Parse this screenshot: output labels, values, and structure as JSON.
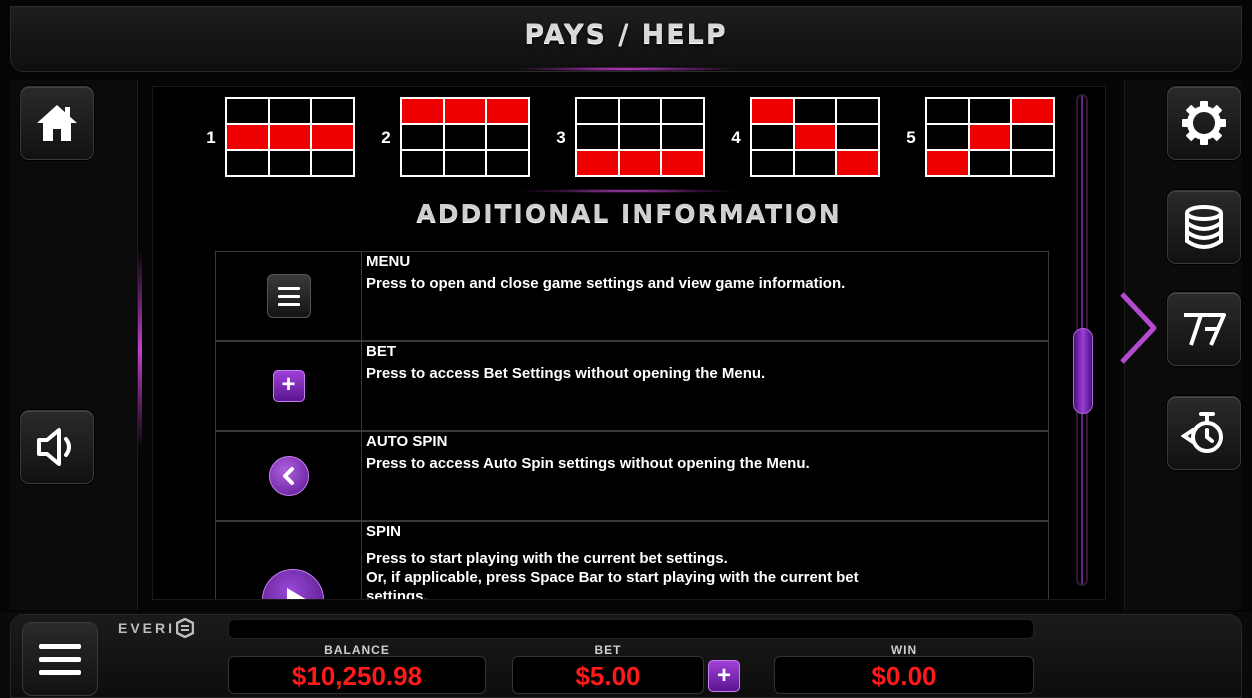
{
  "header": {
    "title": "PAYS / HELP"
  },
  "left_buttons": [
    {
      "name": "home",
      "icon": "home-icon"
    },
    {
      "name": "sound",
      "icon": "speaker-icon"
    }
  ],
  "right_buttons": [
    {
      "name": "settings",
      "icon": "gear-icon"
    },
    {
      "name": "bet-settings",
      "icon": "coin-stack-icon"
    },
    {
      "name": "paytable",
      "icon": "sevens-icon"
    },
    {
      "name": "autospin",
      "icon": "stopwatch-icon"
    }
  ],
  "paylines": [
    {
      "number": "1",
      "cells": [
        0,
        0,
        0,
        1,
        1,
        1,
        0,
        0,
        0
      ]
    },
    {
      "number": "2",
      "cells": [
        1,
        1,
        1,
        0,
        0,
        0,
        0,
        0,
        0
      ]
    },
    {
      "number": "3",
      "cells": [
        0,
        0,
        0,
        0,
        0,
        0,
        1,
        1,
        1
      ]
    },
    {
      "number": "4",
      "cells": [
        1,
        0,
        0,
        0,
        1,
        0,
        0,
        0,
        1
      ]
    },
    {
      "number": "5",
      "cells": [
        0,
        0,
        1,
        0,
        1,
        0,
        1,
        0,
        0
      ]
    }
  ],
  "section_title": "ADDITIONAL INFORMATION",
  "info_rows": [
    {
      "name": "MENU",
      "desc": "Press to open and close game settings and view game information.",
      "icon": "menu-icon"
    },
    {
      "name": "BET",
      "desc": "Press to access Bet Settings without opening the Menu.",
      "icon": "plus-icon"
    },
    {
      "name": "AUTO SPIN",
      "desc": "Press to access Auto Spin settings without opening the Menu.",
      "icon": "chevron-left-icon"
    },
    {
      "name": "SPIN",
      "desc": "Press to start playing with the current bet settings.",
      "desc2": "Or, if applicable, press Space Bar to start playing with the current bet",
      "desc3": "settings.",
      "icon": "play-icon"
    }
  ],
  "brand": "EVERI",
  "meters": {
    "balance_label": "BALANCE",
    "balance_value": "$10,250.98",
    "bet_label": "BET",
    "bet_value": "$5.00",
    "bet_plus": "+",
    "win_label": "WIN",
    "win_value": "$0.00"
  },
  "colors": {
    "accent": "#9a3fd8",
    "meter_text": "#ff1a1a",
    "payline_on": "#ee0000"
  }
}
